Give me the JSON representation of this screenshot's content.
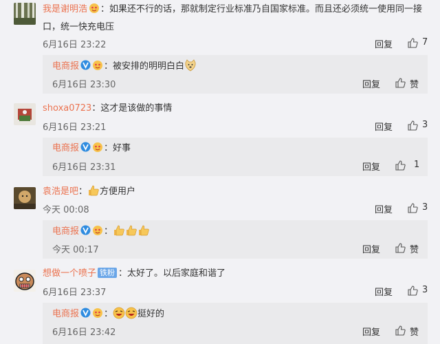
{
  "ui": {
    "reply_label": "回复",
    "like_label": "赞"
  },
  "comments": [
    {
      "user": "我是谢明浩",
      "text_line1": "：如果还不行的话，那就制定行业标准乃自国家标准。而且还必须统一使用同一接",
      "text_line2": "口，统一快充电压",
      "time": "6月16日 23:22",
      "likes": "7",
      "reply": {
        "user": "电商报",
        "text": "：被安排的明明白白",
        "time": "6月16日 23:30"
      }
    },
    {
      "user": "shoxa0723",
      "text": "：这才是该做的事情",
      "time": "6月16日 23:21",
      "likes": "3",
      "reply": {
        "user": "电商报",
        "text": "：好事",
        "time": "6月16日 23:31",
        "likes": "1"
      }
    },
    {
      "user": "袁浩是吧",
      "text": "：",
      "text_after": "方便用户",
      "time": "今天 00:08",
      "likes": "3",
      "reply": {
        "user": "电商报",
        "text": "：",
        "time": "今天 00:17"
      }
    },
    {
      "user": "想做一个喷子",
      "fan_badge": "铁粉",
      "text": "：太好了。以后家庭和谐了",
      "time": "6月16日 23:37",
      "likes": "3",
      "reply": {
        "user": "电商报",
        "text": "：",
        "text_after": "挺好的",
        "time": "6月16日 23:42"
      }
    }
  ]
}
